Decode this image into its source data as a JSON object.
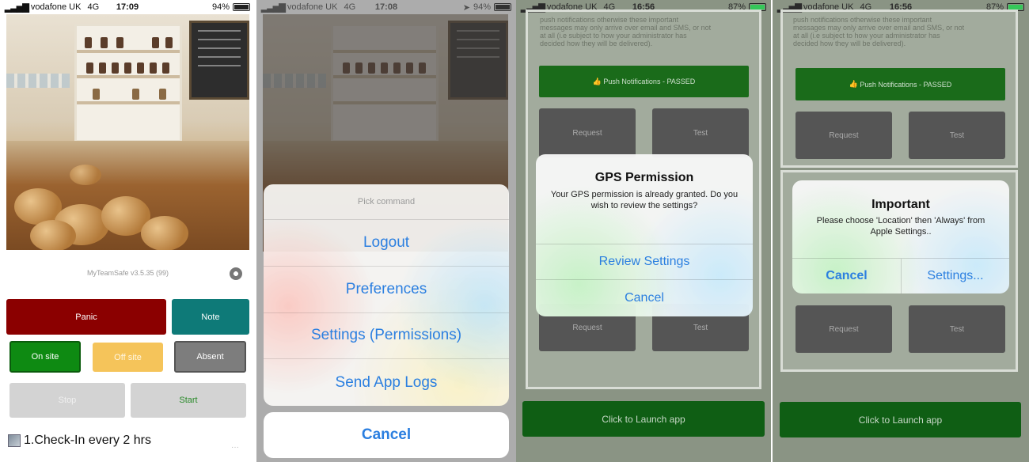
{
  "panel1": {
    "status": {
      "carrier": "vodafone UK",
      "network": "4G",
      "time": "17:09",
      "battery": "94%"
    },
    "version": "MyTeamSafe v3.5.35 (99)",
    "buttons": {
      "panic": "Panic",
      "note": "Note",
      "on_site": "On site",
      "off_site": "Off site",
      "absent": "Absent",
      "stop": "Stop",
      "start": "Start"
    },
    "checkin": "1.Check-In every 2 hrs",
    "colors": {
      "panic": "#8b0000",
      "note": "#0e7a78",
      "on_site": "#0e8a12",
      "off_site": "#f5c45a",
      "absent": "#7d7d7d",
      "stop": "#d3d3d3",
      "start": "#d3d3d3"
    }
  },
  "panel2": {
    "status": {
      "carrier": "vodafone UK",
      "network": "4G",
      "time": "17:08",
      "battery": "94%"
    },
    "sheet_title": "Pick command",
    "items": [
      "Logout",
      "Preferences",
      "Settings (Permissions)",
      "Send App Logs"
    ],
    "cancel": "Cancel"
  },
  "panel3": {
    "status": {
      "carrier": "vodafone UK",
      "network": "4G",
      "time": "16:56",
      "battery": "87%"
    },
    "faint_text": [
      "push notifications otherwise these important",
      "messages may only arrive over email and SMS, or not",
      "at all (i.e subject to how your administrator has",
      "decided how they will be delivered)."
    ],
    "push_label": "Push Notifications - PASSED",
    "request": "Request",
    "test": "Test",
    "alert": {
      "title": "GPS Permission",
      "message": "Your GPS permission is already granted. Do you wish to review the settings?",
      "primary": "Review Settings",
      "cancel": "Cancel"
    },
    "launch": "Click to Launch app"
  },
  "panel4": {
    "status": {
      "carrier": "vodafone UK",
      "network": "4G",
      "time": "16:56",
      "battery": "87%"
    },
    "faint_text": [
      "push notifications otherwise these important",
      "messages may only arrive over email and SMS, or not",
      "at all (i.e subject to how your administrator has",
      "decided how they will be delivered)."
    ],
    "push_label": "Push Notifications - PASSED",
    "request": "Request",
    "test": "Test",
    "alert": {
      "title": "Important",
      "message": "Please choose 'Location' then 'Always' from Apple Settings..",
      "cancel": "Cancel",
      "settings": "Settings..."
    },
    "launch": "Click to Launch app"
  }
}
